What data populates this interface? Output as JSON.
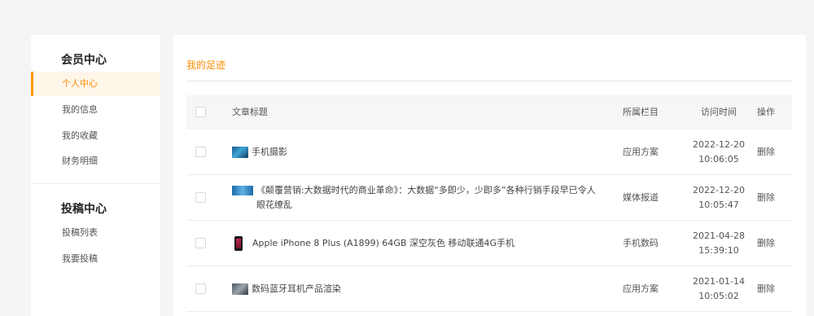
{
  "sidebar": {
    "group1_title": "会员中心",
    "group1_items": [
      {
        "label": "个人中心",
        "active": true
      },
      {
        "label": "我的信息",
        "active": false
      },
      {
        "label": "我的收藏",
        "active": false
      },
      {
        "label": "财务明细",
        "active": false
      }
    ],
    "group2_title": "投稿中心",
    "group2_items": [
      {
        "label": "投稿列表",
        "active": false
      },
      {
        "label": "我要投稿",
        "active": false
      }
    ]
  },
  "main": {
    "title": "我的足迹",
    "table": {
      "headers": {
        "title": "文章标题",
        "category": "所属栏目",
        "time": "访问时间",
        "action": "操作"
      },
      "rows": [
        {
          "thumb": "landscape-photo-thumbnail",
          "title": "手机摄影",
          "category": "应用方案",
          "date": "2022-12-20",
          "time": "10:06:05",
          "action": "删除"
        },
        {
          "thumb": "banner-thumbnail",
          "title": "《颠覆营销:大数据时代的商业革命》：大数据“多即少，少即多”各种行销手段早已令人眼花缭乱",
          "category": "媒体报道",
          "date": "2022-12-20",
          "time": "10:05:47",
          "action": "删除"
        },
        {
          "thumb": "phone-thumbnail",
          "title": "Apple iPhone 8 Plus (A1899) 64GB 深空灰色 移动联通4G手机",
          "category": "手机数码",
          "date": "2021-04-28",
          "time": "15:39:10",
          "action": "删除"
        },
        {
          "thumb": "earphone-thumbnail",
          "title": "数码蓝牙耳机产品渲染",
          "category": "应用方案",
          "date": "2021-01-14",
          "time": "10:05:02",
          "action": "删除"
        }
      ]
    }
  },
  "colors": {
    "accent": "#ff8c00",
    "active_bg": "#fff6ea",
    "page_bg": "#f5f5f5"
  }
}
